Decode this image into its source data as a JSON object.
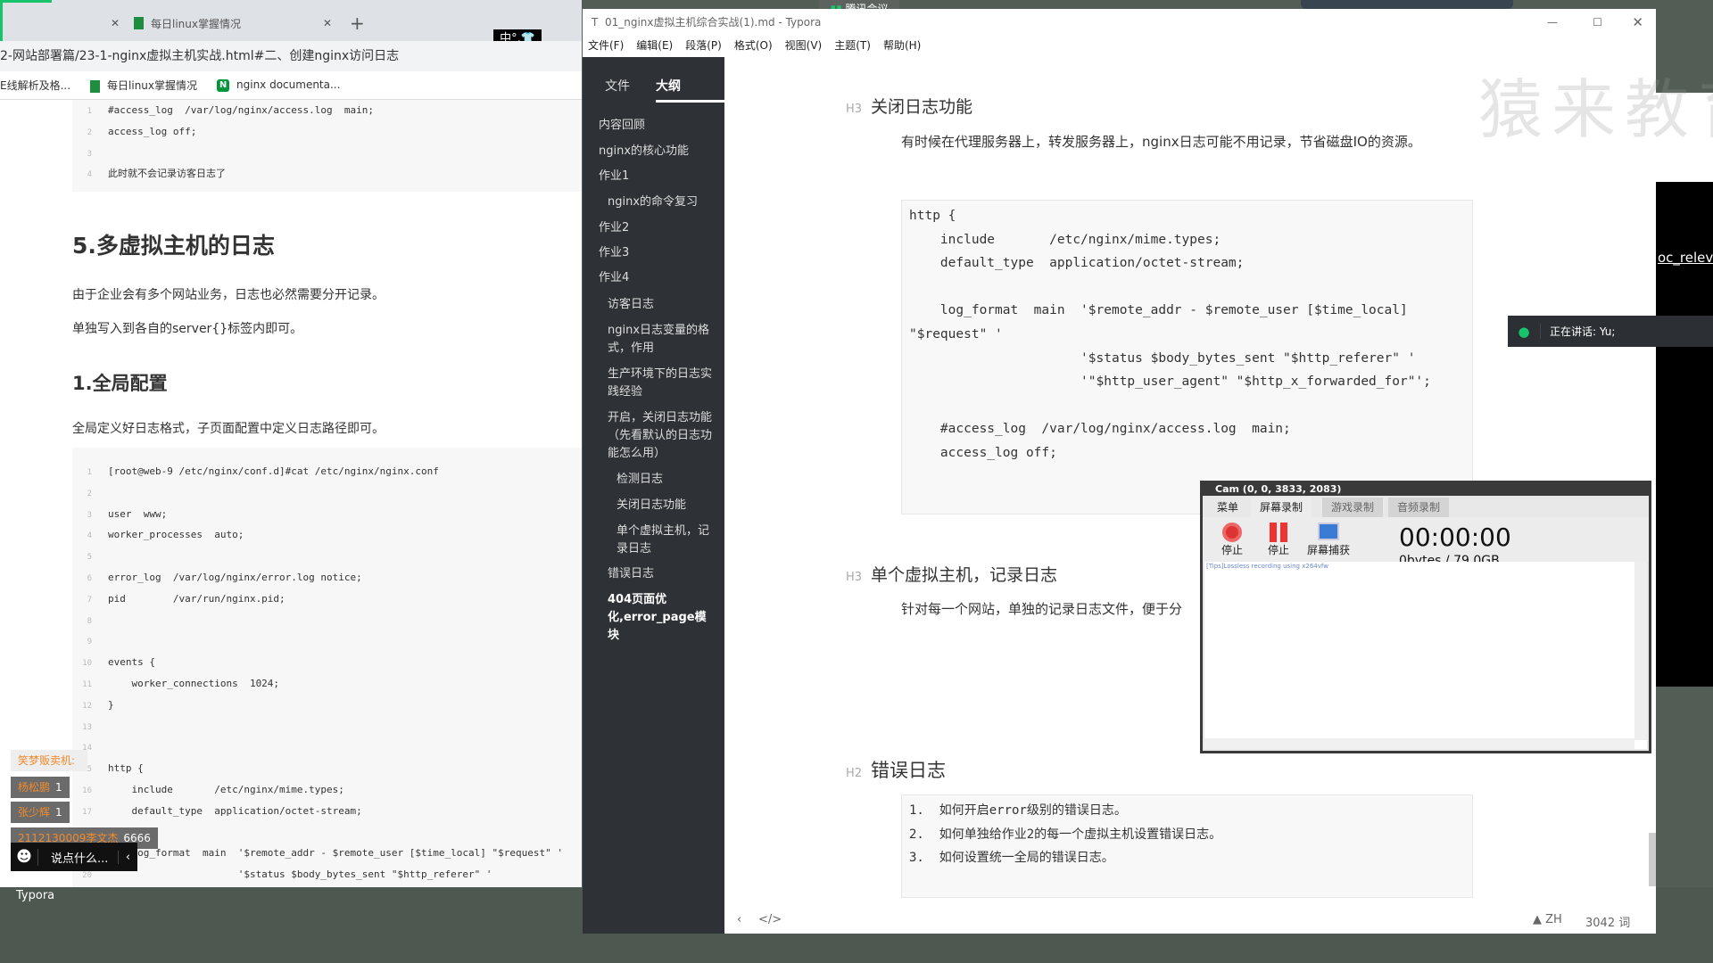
{
  "browser": {
    "tabs": [
      {
        "label": ""
      },
      {
        "label": "每日linux掌握情况"
      }
    ],
    "new_tab": "+",
    "ime": "中°,👕",
    "address": "2-网站部署篇/23-1-nginx虚拟主机实战.html#二、创建nginx访问日志",
    "bookmarks": [
      "E线解析及格...",
      "每日linux掌握情况",
      "nginx documenta..."
    ],
    "code1": [
      {
        "n": "1",
        "t": "#access_log  /var/log/nginx/access.log  main;"
      },
      {
        "n": "2",
        "t": "access_log off;"
      },
      {
        "n": "3",
        "t": ""
      },
      {
        "n": "4",
        "t": "此时就不会记录访客日志了"
      }
    ],
    "heading1": "5.多虚拟主机的日志",
    "para1": "由于企业会有多个网站业务，日志也必然需要分开记录。",
    "para2": "单独写入到各自的server{}标签内即可。",
    "heading2": "1.全局配置",
    "para3": "全局定义好日志格式，子页面配置中定义日志路径即可。",
    "code2": [
      {
        "n": "1",
        "t": "[root@web-9 /etc/nginx/conf.d]#cat /etc/nginx/nginx.conf"
      },
      {
        "n": "2",
        "t": ""
      },
      {
        "n": "3",
        "t": "user  www;"
      },
      {
        "n": "4",
        "t": "worker_processes  auto;"
      },
      {
        "n": "5",
        "t": ""
      },
      {
        "n": "6",
        "t": "error_log  /var/log/nginx/error.log notice;"
      },
      {
        "n": "7",
        "t": "pid        /var/run/nginx.pid;"
      },
      {
        "n": "8",
        "t": ""
      },
      {
        "n": "9",
        "t": ""
      },
      {
        "n": "10",
        "t": "events {"
      },
      {
        "n": "11",
        "t": "    worker_connections  1024;"
      },
      {
        "n": "12",
        "t": "}"
      },
      {
        "n": "13",
        "t": ""
      },
      {
        "n": "14",
        "t": ""
      },
      {
        "n": "15",
        "t": "http {"
      },
      {
        "n": "16",
        "t": "    include       /etc/nginx/mime.types;"
      },
      {
        "n": "17",
        "t": "    default_type  application/octet-stream;"
      },
      {
        "n": "18",
        "t": ""
      },
      {
        "n": "19",
        "t": "    log_format  main  '$remote_addr - $remote_user [$time_local] \"$request\" '"
      },
      {
        "n": "20",
        "t": "                      '$status $body_bytes_sent \"$http_referer\" '"
      }
    ]
  },
  "chat": {
    "messages": [
      {
        "user": "笑梦贩卖机:",
        "text": ""
      },
      {
        "user": "杨松鹏",
        "text": "1"
      },
      {
        "user": "张少辉",
        "text": "1"
      },
      {
        "user": "2112130009李文杰",
        "text": "6666"
      }
    ],
    "input_placeholder": "说点什么..."
  },
  "taskbar": {
    "label": "Typora"
  },
  "meeting_tag": "腾讯会议",
  "typora": {
    "title": "01_nginx虚拟主机综合实战(1).md - Typora",
    "menu": [
      "文件(F)",
      "编辑(E)",
      "段落(P)",
      "格式(O)",
      "视图(V)",
      "主题(T)",
      "帮助(H)"
    ],
    "side_tabs": [
      "文件",
      "大纲"
    ],
    "outline": [
      "内容回顾",
      "nginx的核心功能",
      "作业1",
      "nginx的命令复习",
      "作业2",
      "作业3",
      "作业4",
      "访客日志",
      "nginx日志变量的格式，作用",
      "生产环境下的日志实践经验",
      "开启，关闭日志功能（先看默认的日志功能怎么用）",
      "检测日志",
      "关闭日志功能",
      "单个虚拟主机，记录日志",
      "错误日志",
      "404页面优化,error_page模块"
    ],
    "h3a": "关闭日志功能",
    "h3_label": "H3",
    "h2_label": "H2",
    "para_a": "有时候在代理服务器上，转发服务器上，nginx日志可能不用记录，节省磁盘IO的资源。",
    "code": [
      "http {",
      "    include       /etc/nginx/mime.types;",
      "    default_type  application/octet-stream;",
      "",
      "    log_format  main  '$remote_addr - $remote_user [$time_local]",
      "\"$request\" '",
      "                      '$status $body_bytes_sent \"$http_referer\" '",
      "                      '\"$http_user_agent\" \"$http_x_forwarded_for\"';",
      "",
      "    #access_log  /var/log/nginx/access.log  main;",
      "    access_log off;"
    ],
    "h3b": "单个虚拟主机，记录日志",
    "para_b": "针对每一个网站，单独的记录日志文件，便于分",
    "h2": "错误日志",
    "list": [
      "1.  如何开启error级别的错误日志。",
      "2.  如何单独给作业2的每一个虚拟主机设置错误日志。",
      "3.  如何设置统一全局的错误日志。"
    ],
    "status_lang": "ZH",
    "word_count": "3042 词"
  },
  "cam": {
    "title": "Cam (0, 0, 3833, 2083)",
    "tabs": [
      "菜单",
      "屏幕录制",
      "游戏录制",
      "音频录制"
    ],
    "buttons": [
      "停止",
      "停止",
      "屏幕捕获"
    ],
    "timer": "00:00:00",
    "size": "0bytes / 79.0GB",
    "tip": "[Tips]Lossless recording using x264vfw"
  },
  "right": {
    "link_text": "oc_releva",
    "speaking": "正在讲话: Yu;"
  },
  "watermark": "猿来教育",
  "colors": {
    "accent_green": "#17c46b",
    "sidebar": "#2e3135",
    "desktop": "#525e55"
  }
}
